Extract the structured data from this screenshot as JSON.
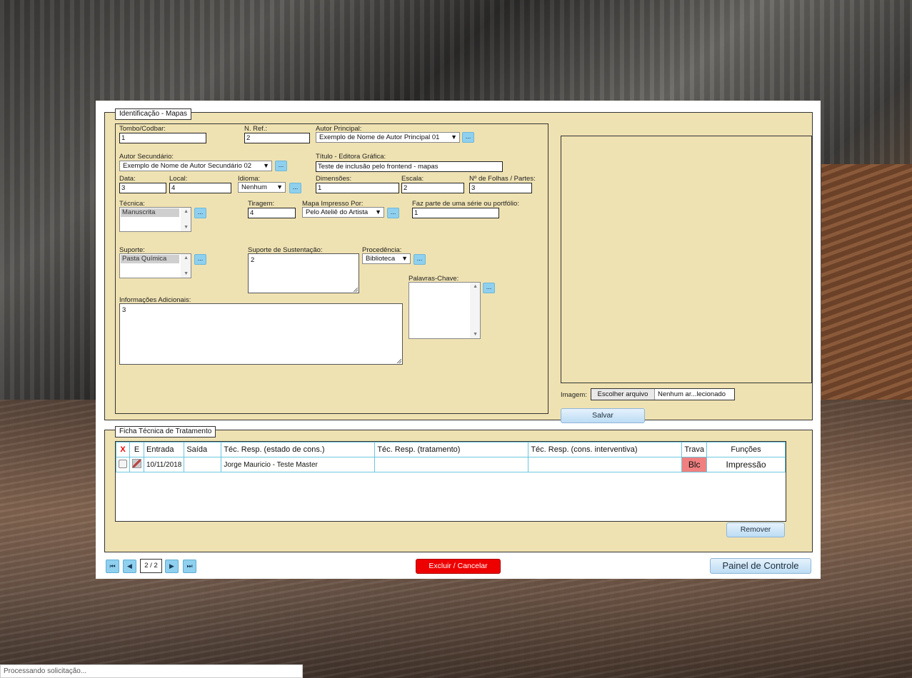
{
  "ident": {
    "legend": "Identificação - Mapas",
    "tombo_label": "Tombo/Codbar:",
    "tombo_value": "1",
    "nref_label": "N. Ref.:",
    "nref_value": "2",
    "autor_principal_label": "Autor Principal:",
    "autor_principal_value": "Exemplo de Nome de Autor Principal 01",
    "autor_secundario_label": "Autor Secundário:",
    "autor_secundario_value": "Exemplo de Nome de Autor Secundário 02",
    "titulo_label": "Título - Editora Gráfica:",
    "titulo_value": "Teste de inclusão pelo frontend - mapas",
    "data_label": "Data:",
    "data_value": "3",
    "local_label": "Local:",
    "local_value": "4",
    "idioma_label": "Idioma:",
    "idioma_value": "Nenhum",
    "dimensoes_label": "Dimensões:",
    "dimensoes_value": "1",
    "escala_label": "Escala:",
    "escala_value": "2",
    "folhas_label": "Nº de Folhas / Partes:",
    "folhas_value": "3",
    "tecnica_label": "Técnica:",
    "tecnica_value": "Manuscrita",
    "tiragem_label": "Tiragem:",
    "tiragem_value": "4",
    "mapa_impresso_label": "Mapa Impresso Por:",
    "mapa_impresso_value": "Pelo Ateliê do Artista",
    "serie_label": "Faz parte de uma série ou portfólio:",
    "serie_value": "1",
    "suporte_label": "Suporte:",
    "suporte_value": "Pasta Química",
    "suporte_sust_label": "Suporte de Sustentação:",
    "suporte_sust_value": "2",
    "procedencia_label": "Procedência:",
    "procedencia_value": "Biblioteca",
    "palavras_label": "Palavras-Chave:",
    "info_label": "Informações Adicionais:",
    "info_value": "3",
    "dots": "...",
    "imagem_label": "Imagem:",
    "file_choose": "Escolher arquivo",
    "file_none": "Nenhum ar...lecionado",
    "salvar": "Salvar"
  },
  "ficha": {
    "legend": "Ficha Técnica de Tratamento",
    "headers": [
      "X",
      "E",
      "Entrada",
      "Saída",
      "Téc. Resp. (estado de cons.)",
      "Téc. Resp. (tratamento)",
      "Téc. Resp. (cons. interventiva)",
      "Trava",
      "Funções"
    ],
    "row": {
      "entrada": "10/11/2018",
      "saida": "",
      "estado": "Jorge Mauricio - Teste Master",
      "tratamento": "",
      "interventiva": "",
      "trava": "Blc",
      "funcoes": "Impressão"
    },
    "remover": "Remover"
  },
  "nav": {
    "page": "2 / 2",
    "excluir": "Excluir / Cancelar",
    "painel": "Painel de Controle"
  },
  "status": "Processando solicitação...",
  "colors": {
    "panel_bg": "#efe2b2",
    "dots_btn": "#8fd0ee",
    "danger": "#ee0000",
    "trava": "#f08080"
  }
}
